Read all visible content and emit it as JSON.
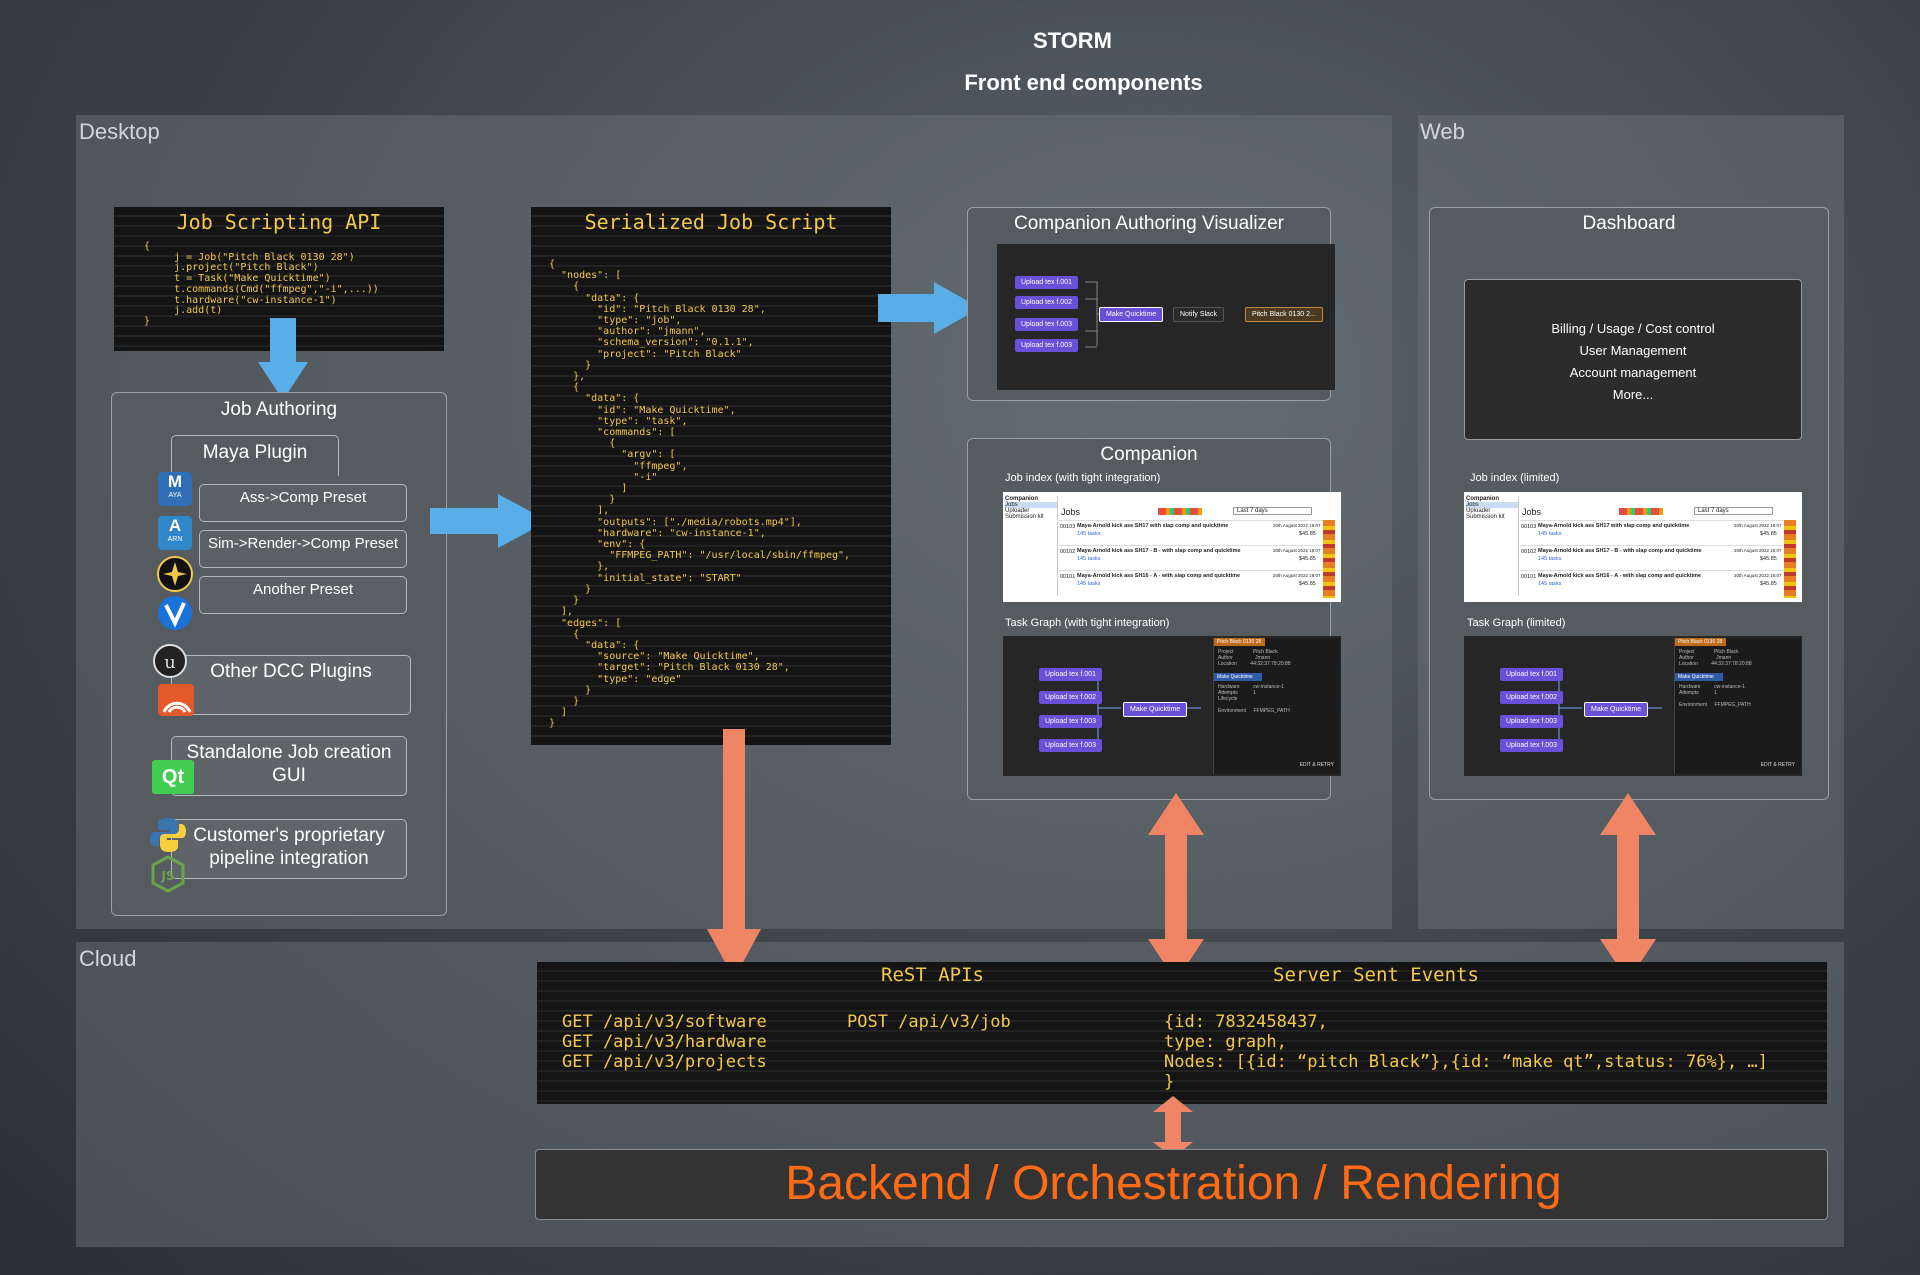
{
  "header": {
    "title": "STORM",
    "subtitle": "Front end components"
  },
  "regions": {
    "desktop": "Desktop",
    "web": "Web",
    "cloud": "Cloud"
  },
  "job_scripting_api": {
    "title": "Job Scripting API",
    "code": "{\n     j = Job(\"Pitch Black 0130 28\")\n     j.project(\"Pitch Black\")\n     t = Task(\"Make Quicktime\")\n     t.commands(Cmd(\"ffmpeg\",\"-i\",...))\n     t.hardware(\"cw-instance-1\")\n     j.add(t)\n}"
  },
  "job_authoring": {
    "title": "Job Authoring",
    "maya_plugin": "Maya Plugin",
    "presets": [
      "Ass->Comp Preset",
      "Sim->Render->Comp Preset",
      "Another Preset"
    ],
    "other_dcc": "Other DCC Plugins",
    "standalone": "Standalone Job creation GUI",
    "customer": "Customer's proprietary pipeline integration",
    "icon_labels": {
      "maya": "M",
      "maya_sub": "AYA",
      "arnold": "A",
      "arnold_sub": "ARN",
      "qt": "Qt"
    }
  },
  "serialized_job_script": {
    "title": "Serialized Job Script",
    "code": "{\n  \"nodes\": [\n    {\n      \"data\": {\n        \"id\": \"Pitch Black 0130 28\",\n        \"type\": \"job\",\n        \"author\": \"jmann\",\n        \"schema_version\": \"0.1.1\",\n        \"project\": \"Pitch Black\"\n      }\n    },\n    {\n      \"data\": {\n        \"id\": \"Make Quicktime\",\n        \"type\": \"task\",\n        \"commands\": [\n          {\n            \"argv\": [\n              \"ffmpeg\",\n              \"-i\"\n            ]\n          }\n        ],\n        \"outputs\": [\"./media/robots.mp4\"],\n        \"hardware\": \"cw-instance-1\",\n        \"env\": {\n          \"FFMPEG_PATH\": \"/usr/local/sbin/ffmpeg\",\n        },\n        \"initial_state\": \"START\"\n      }\n    }\n  ],\n  \"edges\": [\n    {\n      \"data\": {\n        \"source\": \"Make Quicktime\",\n        \"target\": \"Pitch Black 0130 28\",\n        \"type\": \"edge\"\n      }\n    }\n  ]\n}"
  },
  "visualizer": {
    "title": "Companion Authoring Visualizer",
    "uploads": [
      "Upload tex f.001",
      "Upload tex f.002",
      "Upload tex f.003",
      "Upload tex f.003"
    ],
    "make": "Make Quicktime",
    "notify": "Notify Slack",
    "job": "Pitch Black 0130 2..."
  },
  "companion": {
    "title": "Companion",
    "job_index_label": "Job index (with tight integration)",
    "task_graph_label": "Task Graph (with tight integration)",
    "sidebar": [
      "Companion",
      "Jobs",
      "Uploader",
      "Submission kit"
    ],
    "jobs_header": "Jobs",
    "filter": "Last 7 days",
    "rows": [
      {
        "id": "00103",
        "name": "Maya-Arnold kick ass SH17 with slap comp and quicktime",
        "tasks": "145 tasks",
        "date": "20th August 2022 18:07",
        "cost": "$45.85"
      },
      {
        "id": "00102",
        "name": "Maya-Arnold kick ass SH17 - B - with slap comp and quicktime",
        "tasks": "145 tasks",
        "date": "20th August 2022 18:07",
        "cost": "$45.85"
      },
      {
        "id": "00101",
        "name": "Maya-Arnold kick ass SH16 - A - with slap comp and quicktime",
        "tasks": "145 tasks",
        "date": "20th August 2022 18:07",
        "cost": "$45.85"
      }
    ],
    "graph_uploads": [
      "Upload tex f.001",
      "Upload tex f.002",
      "Upload tex f.003",
      "Upload tex f.003"
    ],
    "graph_make": "Make Quicktime",
    "panel_title": "Pitch Black 0130 28",
    "panel_fields": [
      [
        "Project",
        "Pitch Black"
      ],
      [
        "Author",
        "Jmann"
      ],
      [
        "Location",
        "44:32:37:78:20:88"
      ]
    ],
    "panel_task": "Make Quicktime",
    "panel_task_fields": [
      [
        "Hardware",
        "cw-instance-1"
      ],
      [
        "Attempts",
        "1"
      ],
      [
        "Lifecycle",
        ""
      ],
      [
        "Environment",
        "FFMPEG_PATH"
      ]
    ],
    "retry": "EDIT & RETRY"
  },
  "dashboard": {
    "title": "Dashboard",
    "items": [
      "Billing / Usage / Cost control",
      "User Management",
      "Account management",
      "More..."
    ],
    "job_index_label": "Job index  (limited)",
    "task_graph_label": "Task Graph  (limited)"
  },
  "cloud": {
    "rest_title": "ReST APIs",
    "sse_title": "Server Sent Events",
    "gets": [
      "GET /api/v3/software",
      "GET /api/v3/hardware",
      "GET /api/v3/projects"
    ],
    "post": "POST /api/v3/job",
    "sse": [
      "{id: 7832458437,",
      "type: graph,",
      "Nodes: [{id: “pitch Black”},{id: “make qt”,status: 76%}, …]",
      "}"
    ],
    "backend": "Backend / Orchestration / Rendering"
  },
  "colors": {
    "code_text": "#f3c84b",
    "arrow_blue": "#5aaee8",
    "arrow_orange": "#ef8565",
    "backend_text": "#ff6a14",
    "node_purple": "#6a4fd8"
  }
}
